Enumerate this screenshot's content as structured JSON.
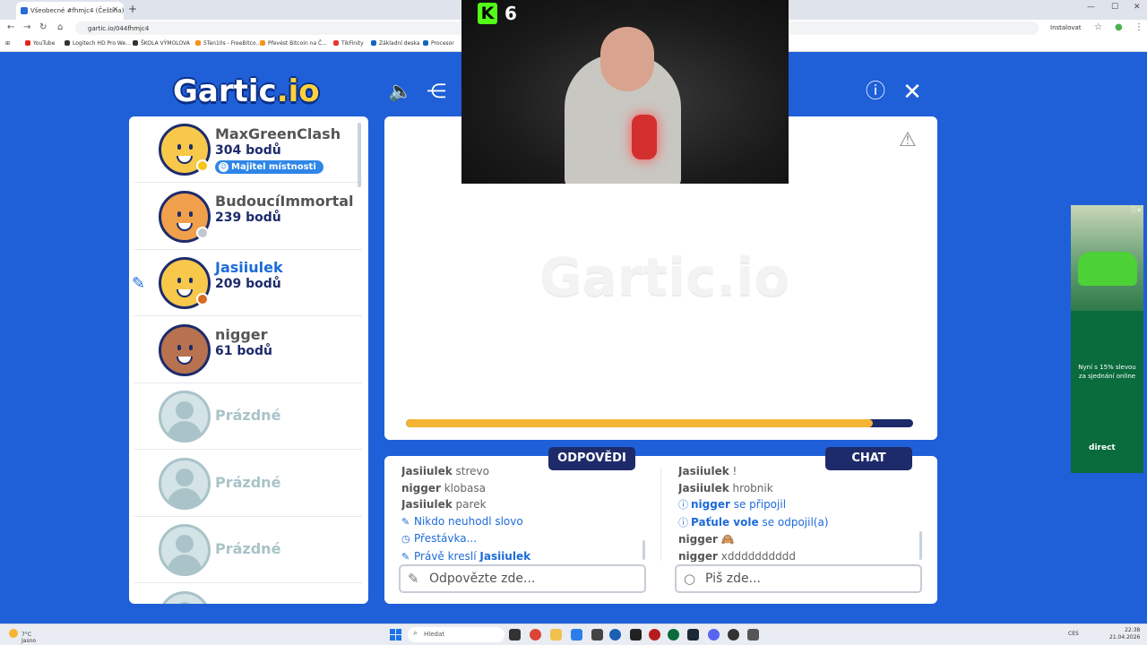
{
  "browser": {
    "tab_title": "Všeobecné #fhmjc4 (Čeština)",
    "url": "gartic.io/044fhmjc4",
    "install_label": "Instalovat",
    "bookmarks": [
      {
        "label": "YouTube",
        "color": "#e62117"
      },
      {
        "label": "Logitech HD Pro We...",
        "color": "#333333"
      },
      {
        "label": "ŠKOLA VÝMOLOVA",
        "color": "#333333"
      },
      {
        "label": "5Ten10s - FreeBitco...",
        "color": "#f7931a"
      },
      {
        "label": "Převést Bitcoin na Č...",
        "color": "#f7931a"
      },
      {
        "label": "TikFinity",
        "color": "#e53935"
      },
      {
        "label": "Základní deska",
        "color": "#1565c0"
      },
      {
        "label": "Procesor",
        "color": "#1565c0"
      }
    ]
  },
  "header": {
    "logo_main": "Gartic",
    "logo_suffix": ".io"
  },
  "players": [
    {
      "name": "MaxGreenClash",
      "score": "304 bodů",
      "badge": "Majitel místnosti",
      "status_color": "#f5c518",
      "avatar_color": "#f7c84a",
      "drawing": false
    },
    {
      "name": "BudoucíImmortal",
      "score": "239 bodů",
      "badge": "",
      "status_color": "#c3c8cf",
      "avatar_color": "#f0a04b",
      "drawing": false
    },
    {
      "name": "Jasiiulek",
      "score": "209 bodů",
      "badge": "",
      "status_color": "#d76b1f",
      "avatar_color": "#f7c84a",
      "drawing": true
    },
    {
      "name": "nigger",
      "score": "61 bodů",
      "badge": "",
      "status_color": "",
      "avatar_color": "#b8724f",
      "drawing": false
    }
  ],
  "empty_slot_label": "Prázdné",
  "canvas": {
    "watermark": "Gartic.io",
    "timer_progress": 0.92
  },
  "stream_overlay": {
    "viewer_count": "6",
    "platform_icon": "kick-icon"
  },
  "answers_panel": {
    "title": "ODPOVĚDI",
    "messages": [
      {
        "user": "Jasiiulek",
        "text": "strevo"
      },
      {
        "user": "nigger",
        "text": "klobasa"
      },
      {
        "user": "Jasiiulek",
        "text": "parek"
      },
      {
        "system": "Nikdo neuhodl slovo",
        "icon": "pencil-icon"
      },
      {
        "system": "Přestávka...",
        "icon": "clock-icon"
      },
      {
        "system": "Právě kreslí",
        "bold": "Jasiiulek",
        "icon": "pencil-icon"
      }
    ],
    "input_placeholder": "Odpovězte zde..."
  },
  "chat_panel": {
    "title": "CHAT",
    "messages": [
      {
        "user": "Jasiiulek",
        "text": "!"
      },
      {
        "user": "Jasiiulek",
        "text": "hrobnik"
      },
      {
        "system_user": "nigger",
        "system": "se připojil",
        "icon": "info-icon"
      },
      {
        "system_user": "Paťule vole",
        "system": "se odpojil(a)",
        "icon": "info-icon"
      },
      {
        "user": "nigger",
        "text": "🙈"
      },
      {
        "user": "nigger",
        "text": "xdddddddddd"
      }
    ],
    "input_placeholder": "Piš zde..."
  },
  "ad": {
    "text": "Nyní s 15% slevou za sjednání online",
    "brand": "direct"
  },
  "taskbar": {
    "weather_temp": "7°C",
    "weather_desc": "Jasno",
    "search_placeholder": "Hledat",
    "language": "CES",
    "time": "22:38",
    "date": "21.04.2026"
  }
}
